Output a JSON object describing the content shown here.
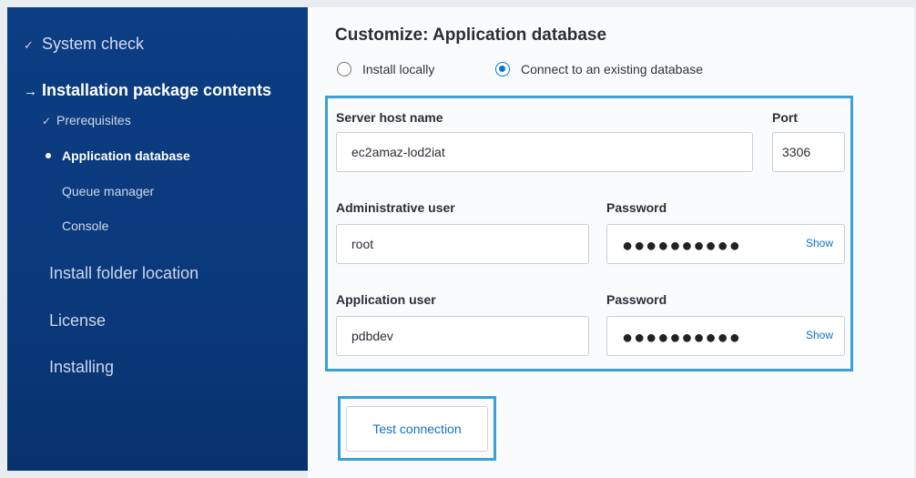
{
  "sidebar": {
    "system_check": "System check",
    "installation_package_contents": "Installation package contents",
    "prerequisites": "Prerequisites",
    "application_database": "Application database",
    "queue_manager": "Queue manager",
    "console": "Console",
    "install_folder_location": "Install folder location",
    "license": "License",
    "installing": "Installing"
  },
  "main": {
    "title": "Customize: Application database",
    "radio_install_locally": "Install locally",
    "radio_connect_existing": "Connect to an existing database",
    "selected_option": "connect_existing",
    "server_host_label": "Server host name",
    "server_host_value": "ec2amaz-lod2iat",
    "port_label": "Port",
    "port_value": "3306",
    "admin_user_label": "Administrative user",
    "admin_user_value": "root",
    "admin_password_label": "Password",
    "admin_password_mask": "●●●●●●●●●●",
    "admin_password_show": "Show",
    "app_user_label": "Application user",
    "app_user_value": "pdbdev",
    "app_password_label": "Password",
    "app_password_mask": "●●●●●●●●●●",
    "app_password_show": "Show",
    "test_connection": "Test connection"
  },
  "colors": {
    "sidebar_bg": "#0a3a7c",
    "highlight": "#3aa0d8",
    "accent": "#0078d4"
  },
  "icons": {
    "done": "check-icon",
    "current": "arrow-right-icon",
    "active_sub": "bullet-icon"
  }
}
